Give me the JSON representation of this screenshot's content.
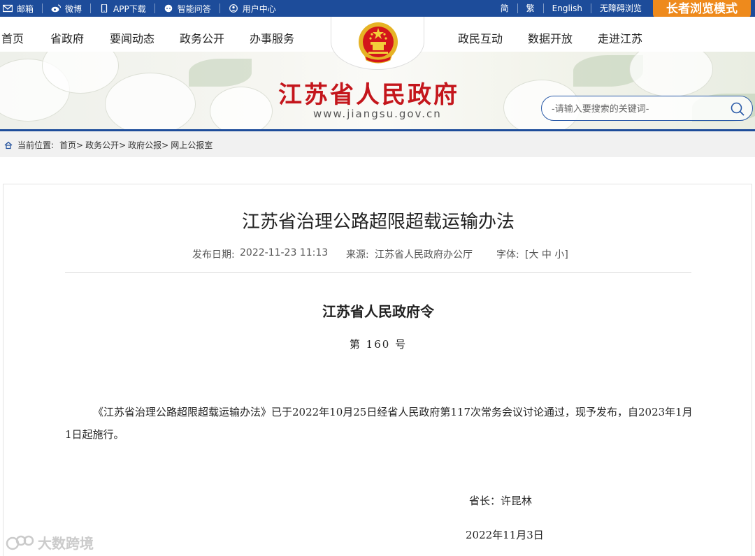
{
  "topbar": {
    "links": [
      {
        "label": "邮箱",
        "icon": "mail-icon"
      },
      {
        "label": "微博",
        "icon": "weibo-icon"
      },
      {
        "label": "APP下载",
        "icon": "phone-icon"
      },
      {
        "label": "智能问答",
        "icon": "chat-icon"
      },
      {
        "label": "用户中心",
        "icon": "user-icon"
      }
    ],
    "right_links": [
      "简",
      "繁",
      "English",
      "无障碍浏览"
    ],
    "elder_mode": "长者浏览模式"
  },
  "nav": {
    "left": [
      "首页",
      "省政府",
      "要闻动态",
      "政务公开",
      "办事服务"
    ],
    "right": [
      "政民互动",
      "数据开放",
      "走进江苏"
    ]
  },
  "banner": {
    "site_title": "江苏省人民政府",
    "site_url": "www.jiangsu.gov.cn",
    "search_placeholder": "-请输入要搜索的关键词-"
  },
  "breadcrumb": {
    "label": "当前位置:",
    "items": [
      "首页>",
      "政务公开>",
      "政府公报>",
      "网上公报室"
    ]
  },
  "article": {
    "title": "江苏省治理公路超限超载运输办法",
    "publish_label": "发布日期:",
    "publish_date": "2022-11-23 11:13",
    "source_label": "来源:",
    "source": "江苏省人民政府办公厅",
    "font_label": "字体:",
    "font_sizes": "[大 中 小]",
    "order_title": "江苏省人民政府令",
    "order_no": "第 160 号",
    "body": "《江苏省治理公路超限超载运输办法》已于2022年10月25日经省人民政府第117次常务会议讨论通过，现予发布，自2023年1月1日起施行。",
    "signature": "省长：许昆林",
    "date": "2022年11月3日"
  },
  "watermark": "大数跨境",
  "colors": {
    "topbar_bg": "#1d4c9a",
    "elder_btn": "#ee8a1c",
    "title_red": "#c4161c"
  }
}
